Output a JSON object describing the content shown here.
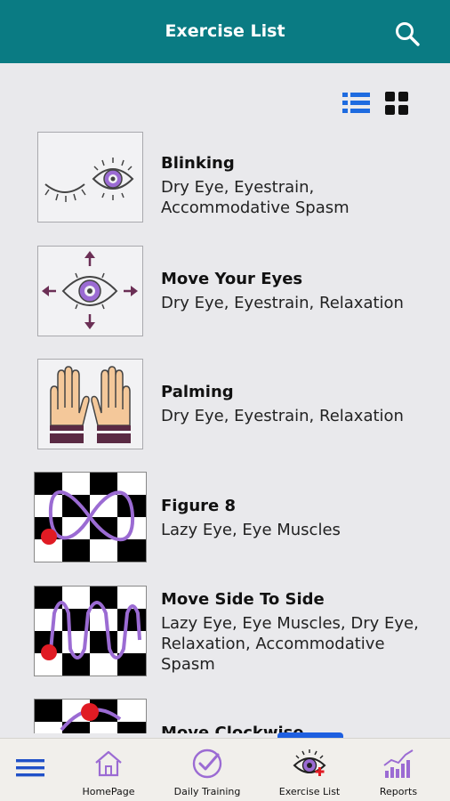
{
  "header": {
    "title": "Exercise List",
    "search_icon": "search-icon"
  },
  "view_toggles": {
    "list_icon": "list-view-icon",
    "grid_icon": "grid-view-icon",
    "active": "list",
    "active_color": "#1e6be0"
  },
  "exercises": [
    {
      "title": "Blinking",
      "description": "Dry Eye, Eyestrain, Accommodative Spasm",
      "thumbnail": "blinking-eye-icon"
    },
    {
      "title": "Move Your Eyes",
      "description": "Dry Eye, Eyestrain, Relaxation",
      "thumbnail": "eye-arrows-icon"
    },
    {
      "title": "Palming",
      "description": "Dry Eye, Eyestrain, Relaxation",
      "thumbnail": "palming-hands-icon"
    },
    {
      "title": "Figure 8",
      "description": "Lazy Eye, Eye Muscles",
      "thumbnail": "figure-eight-checkerboard"
    },
    {
      "title": "Move Side To Side",
      "description": "Lazy Eye, Eye Muscles, Dry Eye, Relaxation, Accommodative Spasm",
      "thumbnail": "side-to-side-checkerboard"
    },
    {
      "title": "Move Clockwise",
      "description": "",
      "thumbnail": "clockwise-checkerboard"
    }
  ],
  "bottom_nav": {
    "menu_icon": "hamburger-menu-icon",
    "items": [
      {
        "label": "HomePage",
        "icon": "home-icon"
      },
      {
        "label": "Daily Training",
        "icon": "check-circle-icon"
      },
      {
        "label": "Exercise List",
        "icon": "eye-plus-icon",
        "active": true
      },
      {
        "label": "Reports",
        "icon": "chart-icon"
      }
    ]
  },
  "colors": {
    "header": "#0a7b83",
    "accent_purple": "#9b6bd3",
    "marker_red": "#e01b24",
    "active_blue": "#1e6be0"
  }
}
